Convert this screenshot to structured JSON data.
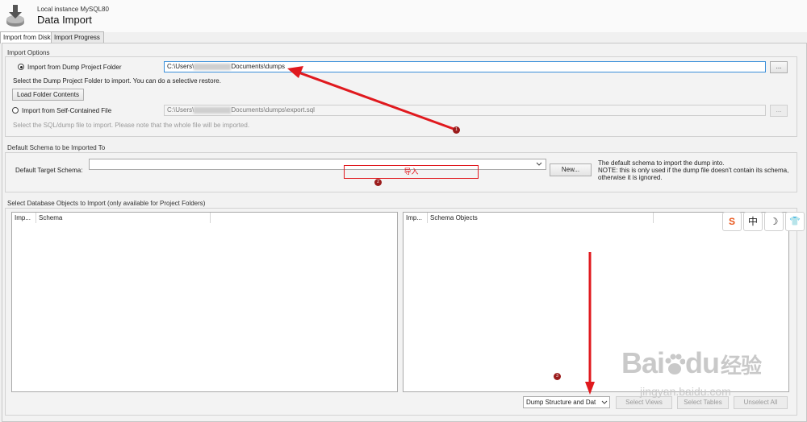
{
  "header": {
    "instance": "Local instance MySQL80",
    "title": "Data Import"
  },
  "tabs": [
    {
      "label": "Import from Disk"
    },
    {
      "label": "Import Progress"
    }
  ],
  "import_options": {
    "label": "Import Options",
    "folder_option": "Import from Dump Project Folder",
    "folder_path_start": "C:\\Users\\",
    "folder_path_end": "Documents\\dumps",
    "browse": "...",
    "folder_hint": "Select the Dump Project Folder to import. You can do a selective restore.",
    "load_button": "Load Folder Contents",
    "file_option": "Import from Self-Contained File",
    "file_path_start": "C:\\Users\\",
    "file_path_end": "Documents\\dumps\\export.sql",
    "file_hint": "Select the SQL/dump file to import. Please note that the whole file will be imported."
  },
  "schema": {
    "label": "Default Schema to be Imported To",
    "target_label": "Default Target Schema:",
    "target_value": "",
    "new_button": "New...",
    "note_line1": "The default schema to import the dump into.",
    "note_line2": "NOTE: this is only used if the dump file doesn't contain its schema,",
    "note_line3": "otherwise it is ignored."
  },
  "annotation_text": "导入",
  "objects": {
    "label": "Select Database Objects to Import (only available for Project Folders)",
    "left_columns": [
      "Imp...",
      "Schema"
    ],
    "right_columns": [
      "Imp...",
      "Schema Objects"
    ],
    "dump_option": "Dump Structure and Dat",
    "select_views": "Select Views",
    "select_tables": "Select Tables",
    "unselect_all": "Unselect All"
  },
  "badges": [
    "1",
    "2",
    "3"
  ],
  "toolbar_icons": [
    "sogou-s-icon",
    "chinese-mode-icon",
    "moon-icon",
    "shirt-icon"
  ],
  "toolbar_labels": [
    "S",
    "中",
    "☽",
    "👕"
  ],
  "watermark": {
    "line1": "Bai",
    "line2": "du",
    "line3": "经验",
    "url": "jingyan.baidu.com"
  },
  "colors": {
    "annotation_red": "#e0191e",
    "badge": "#9b1c1c",
    "focus_border": "#3a8fd9"
  }
}
